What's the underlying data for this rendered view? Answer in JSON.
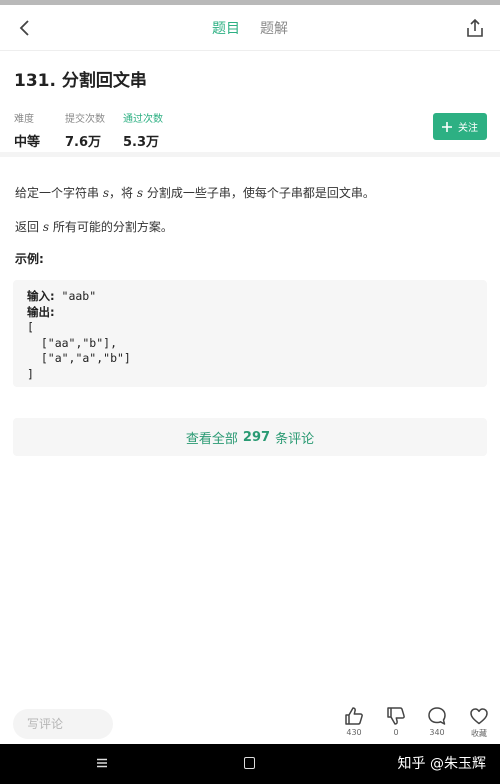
{
  "header": {
    "tabs": [
      {
        "label": "题目",
        "active": true
      },
      {
        "label": "题解",
        "active": false
      }
    ]
  },
  "problem": {
    "title": "131. 分割回文串",
    "stats": [
      {
        "label": "难度",
        "value": "中等"
      },
      {
        "label": "提交次数",
        "value": "7.6万"
      },
      {
        "label": "通过次数",
        "value": "5.3万"
      }
    ],
    "follow_label": "关注",
    "desc_line1_a": "给定一个字符串 ",
    "desc_var": "s",
    "desc_line1_b": "，将 ",
    "desc_line1_c": " 分割成一些子串，使每个子串都是回文串。",
    "desc_line2_a": "返回 ",
    "desc_line2_b": " 所有可能的分割方案。",
    "example_label": "示例:",
    "example": {
      "input_label": "输入:",
      "input_value": " \"aab\"",
      "output_label": "输出:",
      "lines": [
        "[",
        "  [\"aa\",\"b\"],",
        "  [\"a\",\"a\",\"b\"]",
        "]"
      ]
    }
  },
  "comments": {
    "prefix": "查看全部",
    "count": "297",
    "suffix": "条评论"
  },
  "bottom": {
    "comment_placeholder": "写评论",
    "like_count": "430",
    "dislike_count": "0",
    "comment_count": "340",
    "favorite_label": "收藏"
  },
  "watermark": "知乎 @朱玉辉",
  "colors": {
    "accent": "#2db083"
  }
}
